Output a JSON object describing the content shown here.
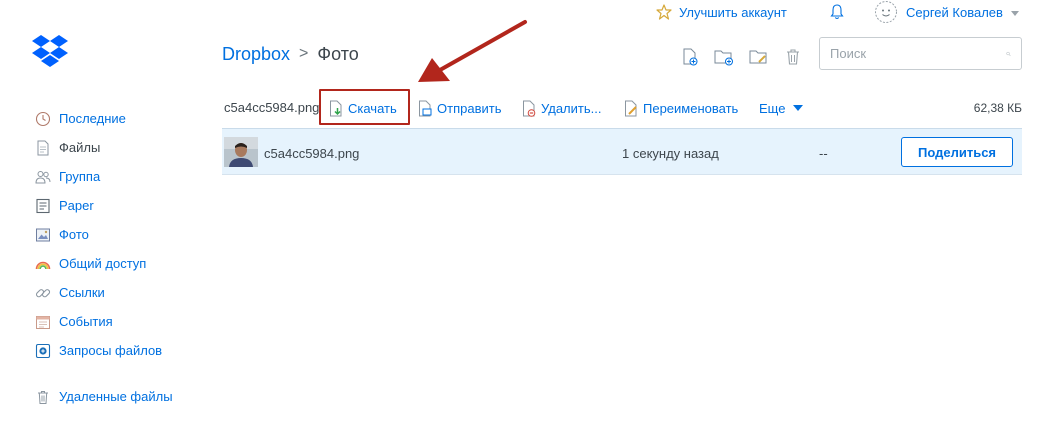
{
  "topbar": {
    "upgrade_label": "Улучшить аккаунт",
    "user_name": "Сергей Ковалев"
  },
  "breadcrumb": {
    "root": "Dropbox",
    "separator": ">",
    "current": "Фото"
  },
  "search": {
    "placeholder": "Поиск"
  },
  "sidebar": {
    "items": [
      {
        "label": "Последние",
        "icon": "clock-icon"
      },
      {
        "label": "Файлы",
        "icon": "file-icon"
      },
      {
        "label": "Группа",
        "icon": "group-icon"
      },
      {
        "label": "Paper",
        "icon": "paper-icon"
      },
      {
        "label": "Фото",
        "icon": "photo-icon"
      },
      {
        "label": "Общий доступ",
        "icon": "rainbow-icon"
      },
      {
        "label": "Ссылки",
        "icon": "link-icon"
      },
      {
        "label": "События",
        "icon": "calendar-icon"
      },
      {
        "label": "Запросы файлов",
        "icon": "file-request-icon"
      },
      {
        "label": "Удаленные файлы",
        "icon": "trash-icon"
      }
    ],
    "active_index": 1
  },
  "actions": {
    "selected_file": "c5a4cc5984.png",
    "download": "Скачать",
    "send": "Отправить",
    "delete": "Удалить...",
    "rename": "Переименовать",
    "more": "Еще",
    "size": "62,38 КБ"
  },
  "table": {
    "rows": [
      {
        "name": "c5a4cc5984.png",
        "modified": "1 секунду назад",
        "members": "--",
        "share_label": "Поделиться"
      }
    ]
  },
  "colors": {
    "accent": "#0070e0",
    "highlight_box": "#b2261c",
    "selected_row": "#e6f3fd"
  }
}
